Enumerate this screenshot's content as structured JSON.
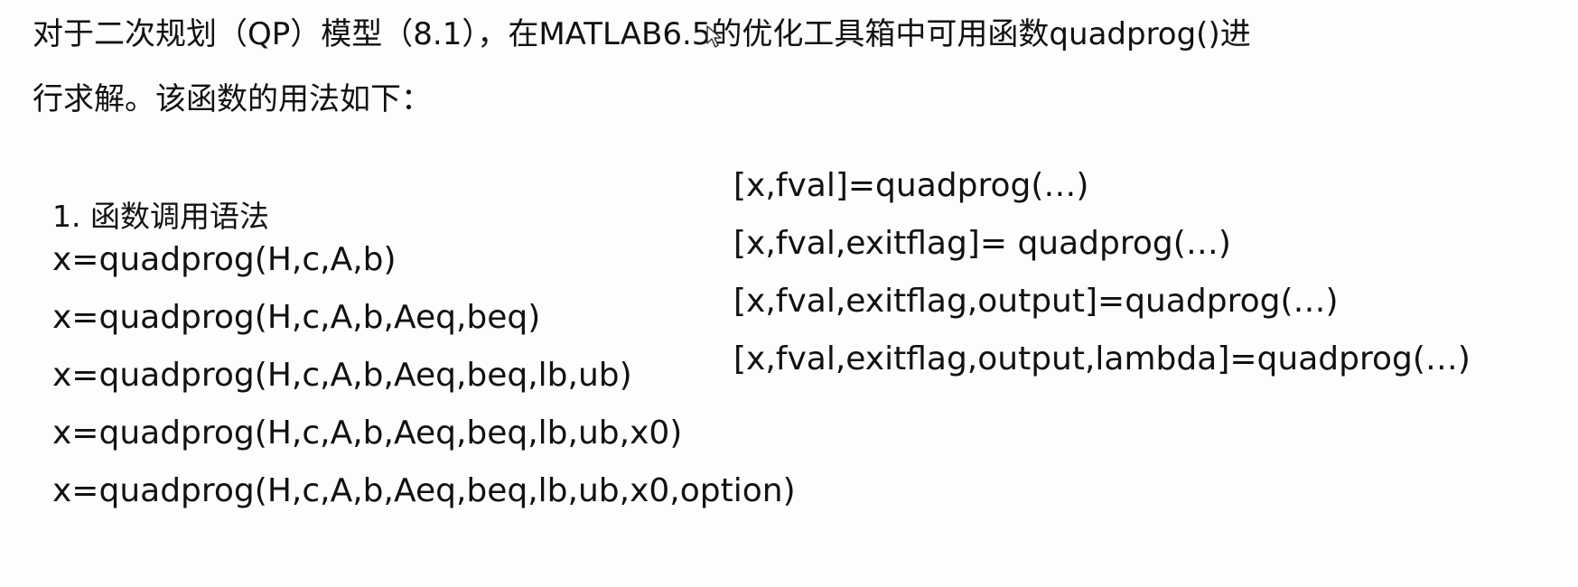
{
  "intro": {
    "line1": "对于二次规划（QP）模型（8.1），在MATLAB6.5的优化工具箱中可用函数quadprog()进",
    "line2": "行求解。该函数的用法如下："
  },
  "section_heading": "1. 函数调用语法",
  "left_syntax": [
    "x=quadprog(H,c,A,b)",
    "x=quadprog(H,c,A,b,Aeq,beq)",
    "x=quadprog(H,c,A,b,Aeq,beq,lb,ub)",
    "x=quadprog(H,c,A,b,Aeq,beq,lb,ub,x0)",
    "x=quadprog(H,c,A,b,Aeq,beq,lb,ub,x0,option)"
  ],
  "right_syntax": [
    "[x,fval]=quadprog(…)",
    "[x,fval,exitflag]= quadprog(…)",
    "[x,fval,exitflag,output]=quadprog(…)",
    "[x,fval,exitflag,output,lambda]=quadprog(…)"
  ]
}
